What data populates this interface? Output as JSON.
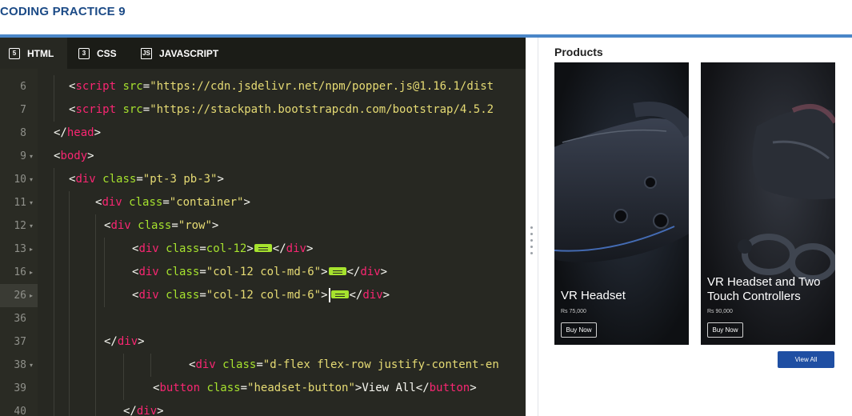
{
  "page": {
    "title": "CODING PRACTICE 9"
  },
  "colors": {
    "accent": "#4a86c8",
    "title": "#1b4a86",
    "editor_bg": "#272822",
    "tag": "#f92672",
    "attr": "#a6e22e",
    "string": "#e6db74",
    "view_all_bg": "#1f4fa3"
  },
  "editor": {
    "tabs": [
      {
        "label": "HTML",
        "icon": "html5-icon",
        "active": true
      },
      {
        "label": "CSS",
        "icon": "css3-icon",
        "active": false
      },
      {
        "label": "JAVASCRIPT",
        "icon": "javascript-file-icon",
        "active": false
      }
    ],
    "lines": [
      {
        "num": "6",
        "fold": "",
        "code": "<script src=\"https://cdn.jsdelivr.net/npm/popper.js@1.16.1/dist"
      },
      {
        "num": "7",
        "fold": "",
        "code": "<script src=\"https://stackpath.bootstrapcdn.com/bootstrap/4.5.2"
      },
      {
        "num": "8",
        "fold": "",
        "code": "</head>"
      },
      {
        "num": "9",
        "fold": "▾",
        "code": "<body>"
      },
      {
        "num": "10",
        "fold": "▾",
        "code": "<div class=\"pt-3 pb-3\">"
      },
      {
        "num": "11",
        "fold": "▾",
        "code": "<div class=\"container\">"
      },
      {
        "num": "12",
        "fold": "▾",
        "code": "<div class=\"row\">"
      },
      {
        "num": "13",
        "fold": "▸",
        "code": "<div class=col-12>⟺</div>"
      },
      {
        "num": "16",
        "fold": "▸",
        "code": "<div class=\"col-12 col-md-6\">⟺</div>"
      },
      {
        "num": "26",
        "fold": "▸",
        "code": "<div class=\"col-12 col-md-6\">⟺</div>"
      },
      {
        "num": "36",
        "fold": "",
        "code": ""
      },
      {
        "num": "37",
        "fold": "",
        "code": "</div>"
      },
      {
        "num": "38",
        "fold": "▾",
        "code": "<div class=\"d-flex flex-row justify-content-en"
      },
      {
        "num": "39",
        "fold": "",
        "code": "<button class=\"headset-button\">View All</button>"
      },
      {
        "num": "40",
        "fold": "",
        "code": "</div>"
      }
    ]
  },
  "preview": {
    "heading": "Products",
    "products": [
      {
        "name": "VR Headset",
        "price": "Rs 75,000",
        "button": "Buy Now",
        "image": "vr-headset-image"
      },
      {
        "name": "VR Headset and Two Touch Controllers",
        "price": "Rs 90,000",
        "button": "Buy Now",
        "image": "vr-headset-controllers-image"
      }
    ],
    "view_all": "View All"
  }
}
